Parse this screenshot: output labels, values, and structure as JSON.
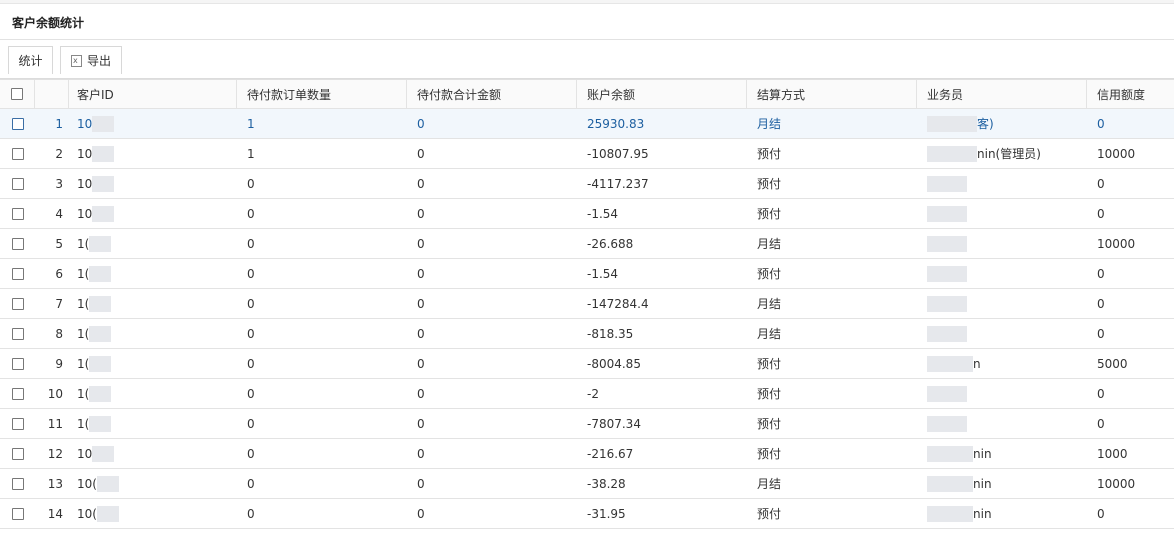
{
  "panel": {
    "title": "客户余额统计"
  },
  "toolbar": {
    "stat_label": "统计",
    "export_label": "导出",
    "export_icon": "excel-icon"
  },
  "table": {
    "headers": [
      "客户ID",
      "待付款订单数量",
      "待付款合计金额",
      "账户余额",
      "结算方式",
      "业务员",
      "信用额度"
    ],
    "rows": [
      {
        "no": "1",
        "id": "10",
        "cnt": "1",
        "amt": "0",
        "bal": "25930.83",
        "set": "月结",
        "rep": "客)",
        "cred": "0"
      },
      {
        "no": "2",
        "id": "10",
        "cnt": "1",
        "amt": "0",
        "bal": "-10807.95",
        "set": "预付",
        "rep": "nin(管理员)",
        "cred": "10000"
      },
      {
        "no": "3",
        "id": "10",
        "cnt": "0",
        "amt": "0",
        "bal": "-4117.237",
        "set": "预付",
        "rep": "",
        "cred": "0"
      },
      {
        "no": "4",
        "id": "10",
        "cnt": "0",
        "amt": "0",
        "bal": "-1.54",
        "set": "预付",
        "rep": "",
        "cred": "0"
      },
      {
        "no": "5",
        "id": "1(",
        "cnt": "0",
        "amt": "0",
        "bal": "-26.688",
        "set": "月结",
        "rep": "",
        "cred": "10000"
      },
      {
        "no": "6",
        "id": "1(",
        "cnt": "0",
        "amt": "0",
        "bal": "-1.54",
        "set": "预付",
        "rep": "",
        "cred": "0"
      },
      {
        "no": "7",
        "id": "1(",
        "cnt": "0",
        "amt": "0",
        "bal": "-147284.4",
        "set": "月结",
        "rep": "",
        "cred": "0"
      },
      {
        "no": "8",
        "id": "1(",
        "cnt": "0",
        "amt": "0",
        "bal": "-818.35",
        "set": "月结",
        "rep": "",
        "cred": "0"
      },
      {
        "no": "9",
        "id": "1(",
        "cnt": "0",
        "amt": "0",
        "bal": "-8004.85",
        "set": "预付",
        "rep": "n",
        "cred": "5000"
      },
      {
        "no": "10",
        "id": "1(",
        "cnt": "0",
        "amt": "0",
        "bal": "-2",
        "set": "预付",
        "rep": "",
        "cred": "0"
      },
      {
        "no": "11",
        "id": "1(",
        "cnt": "0",
        "amt": "0",
        "bal": "-7807.34",
        "set": "预付",
        "rep": "",
        "cred": "0"
      },
      {
        "no": "12",
        "id": "10",
        "cnt": "0",
        "amt": "0",
        "bal": "-216.67",
        "set": "预付",
        "rep": "nin",
        "cred": "1000"
      },
      {
        "no": "13",
        "id": "10(",
        "cnt": "0",
        "amt": "0",
        "bal": "-38.28",
        "set": "月结",
        "rep": "nin",
        "cred": "10000"
      },
      {
        "no": "14",
        "id": "10(",
        "cnt": "0",
        "amt": "0",
        "bal": "-31.95",
        "set": "预付",
        "rep": "nin",
        "cred": "0"
      }
    ]
  }
}
